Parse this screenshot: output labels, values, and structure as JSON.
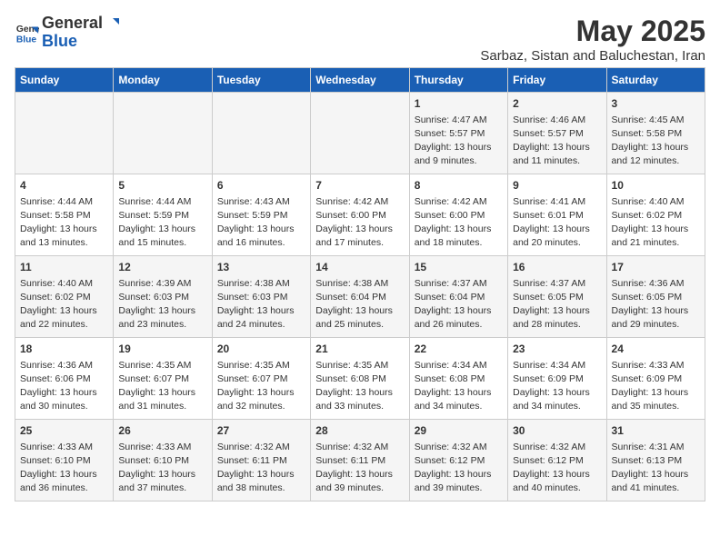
{
  "logo": {
    "line1": "General",
    "line2": "Blue"
  },
  "title": "May 2025",
  "subtitle": "Sarbaz, Sistan and Baluchestan, Iran",
  "days": [
    "Sunday",
    "Monday",
    "Tuesday",
    "Wednesday",
    "Thursday",
    "Friday",
    "Saturday"
  ],
  "weeks": [
    [
      {
        "day": "",
        "content": ""
      },
      {
        "day": "",
        "content": ""
      },
      {
        "day": "",
        "content": ""
      },
      {
        "day": "",
        "content": ""
      },
      {
        "day": "1",
        "content": "Sunrise: 4:47 AM\nSunset: 5:57 PM\nDaylight: 13 hours and 9 minutes."
      },
      {
        "day": "2",
        "content": "Sunrise: 4:46 AM\nSunset: 5:57 PM\nDaylight: 13 hours and 11 minutes."
      },
      {
        "day": "3",
        "content": "Sunrise: 4:45 AM\nSunset: 5:58 PM\nDaylight: 13 hours and 12 minutes."
      }
    ],
    [
      {
        "day": "4",
        "content": "Sunrise: 4:44 AM\nSunset: 5:58 PM\nDaylight: 13 hours and 13 minutes."
      },
      {
        "day": "5",
        "content": "Sunrise: 4:44 AM\nSunset: 5:59 PM\nDaylight: 13 hours and 15 minutes."
      },
      {
        "day": "6",
        "content": "Sunrise: 4:43 AM\nSunset: 5:59 PM\nDaylight: 13 hours and 16 minutes."
      },
      {
        "day": "7",
        "content": "Sunrise: 4:42 AM\nSunset: 6:00 PM\nDaylight: 13 hours and 17 minutes."
      },
      {
        "day": "8",
        "content": "Sunrise: 4:42 AM\nSunset: 6:00 PM\nDaylight: 13 hours and 18 minutes."
      },
      {
        "day": "9",
        "content": "Sunrise: 4:41 AM\nSunset: 6:01 PM\nDaylight: 13 hours and 20 minutes."
      },
      {
        "day": "10",
        "content": "Sunrise: 4:40 AM\nSunset: 6:02 PM\nDaylight: 13 hours and 21 minutes."
      }
    ],
    [
      {
        "day": "11",
        "content": "Sunrise: 4:40 AM\nSunset: 6:02 PM\nDaylight: 13 hours and 22 minutes."
      },
      {
        "day": "12",
        "content": "Sunrise: 4:39 AM\nSunset: 6:03 PM\nDaylight: 13 hours and 23 minutes."
      },
      {
        "day": "13",
        "content": "Sunrise: 4:38 AM\nSunset: 6:03 PM\nDaylight: 13 hours and 24 minutes."
      },
      {
        "day": "14",
        "content": "Sunrise: 4:38 AM\nSunset: 6:04 PM\nDaylight: 13 hours and 25 minutes."
      },
      {
        "day": "15",
        "content": "Sunrise: 4:37 AM\nSunset: 6:04 PM\nDaylight: 13 hours and 26 minutes."
      },
      {
        "day": "16",
        "content": "Sunrise: 4:37 AM\nSunset: 6:05 PM\nDaylight: 13 hours and 28 minutes."
      },
      {
        "day": "17",
        "content": "Sunrise: 4:36 AM\nSunset: 6:05 PM\nDaylight: 13 hours and 29 minutes."
      }
    ],
    [
      {
        "day": "18",
        "content": "Sunrise: 4:36 AM\nSunset: 6:06 PM\nDaylight: 13 hours and 30 minutes."
      },
      {
        "day": "19",
        "content": "Sunrise: 4:35 AM\nSunset: 6:07 PM\nDaylight: 13 hours and 31 minutes."
      },
      {
        "day": "20",
        "content": "Sunrise: 4:35 AM\nSunset: 6:07 PM\nDaylight: 13 hours and 32 minutes."
      },
      {
        "day": "21",
        "content": "Sunrise: 4:35 AM\nSunset: 6:08 PM\nDaylight: 13 hours and 33 minutes."
      },
      {
        "day": "22",
        "content": "Sunrise: 4:34 AM\nSunset: 6:08 PM\nDaylight: 13 hours and 34 minutes."
      },
      {
        "day": "23",
        "content": "Sunrise: 4:34 AM\nSunset: 6:09 PM\nDaylight: 13 hours and 34 minutes."
      },
      {
        "day": "24",
        "content": "Sunrise: 4:33 AM\nSunset: 6:09 PM\nDaylight: 13 hours and 35 minutes."
      }
    ],
    [
      {
        "day": "25",
        "content": "Sunrise: 4:33 AM\nSunset: 6:10 PM\nDaylight: 13 hours and 36 minutes."
      },
      {
        "day": "26",
        "content": "Sunrise: 4:33 AM\nSunset: 6:10 PM\nDaylight: 13 hours and 37 minutes."
      },
      {
        "day": "27",
        "content": "Sunrise: 4:32 AM\nSunset: 6:11 PM\nDaylight: 13 hours and 38 minutes."
      },
      {
        "day": "28",
        "content": "Sunrise: 4:32 AM\nSunset: 6:11 PM\nDaylight: 13 hours and 39 minutes."
      },
      {
        "day": "29",
        "content": "Sunrise: 4:32 AM\nSunset: 6:12 PM\nDaylight: 13 hours and 39 minutes."
      },
      {
        "day": "30",
        "content": "Sunrise: 4:32 AM\nSunset: 6:12 PM\nDaylight: 13 hours and 40 minutes."
      },
      {
        "day": "31",
        "content": "Sunrise: 4:31 AM\nSunset: 6:13 PM\nDaylight: 13 hours and 41 minutes."
      }
    ]
  ]
}
